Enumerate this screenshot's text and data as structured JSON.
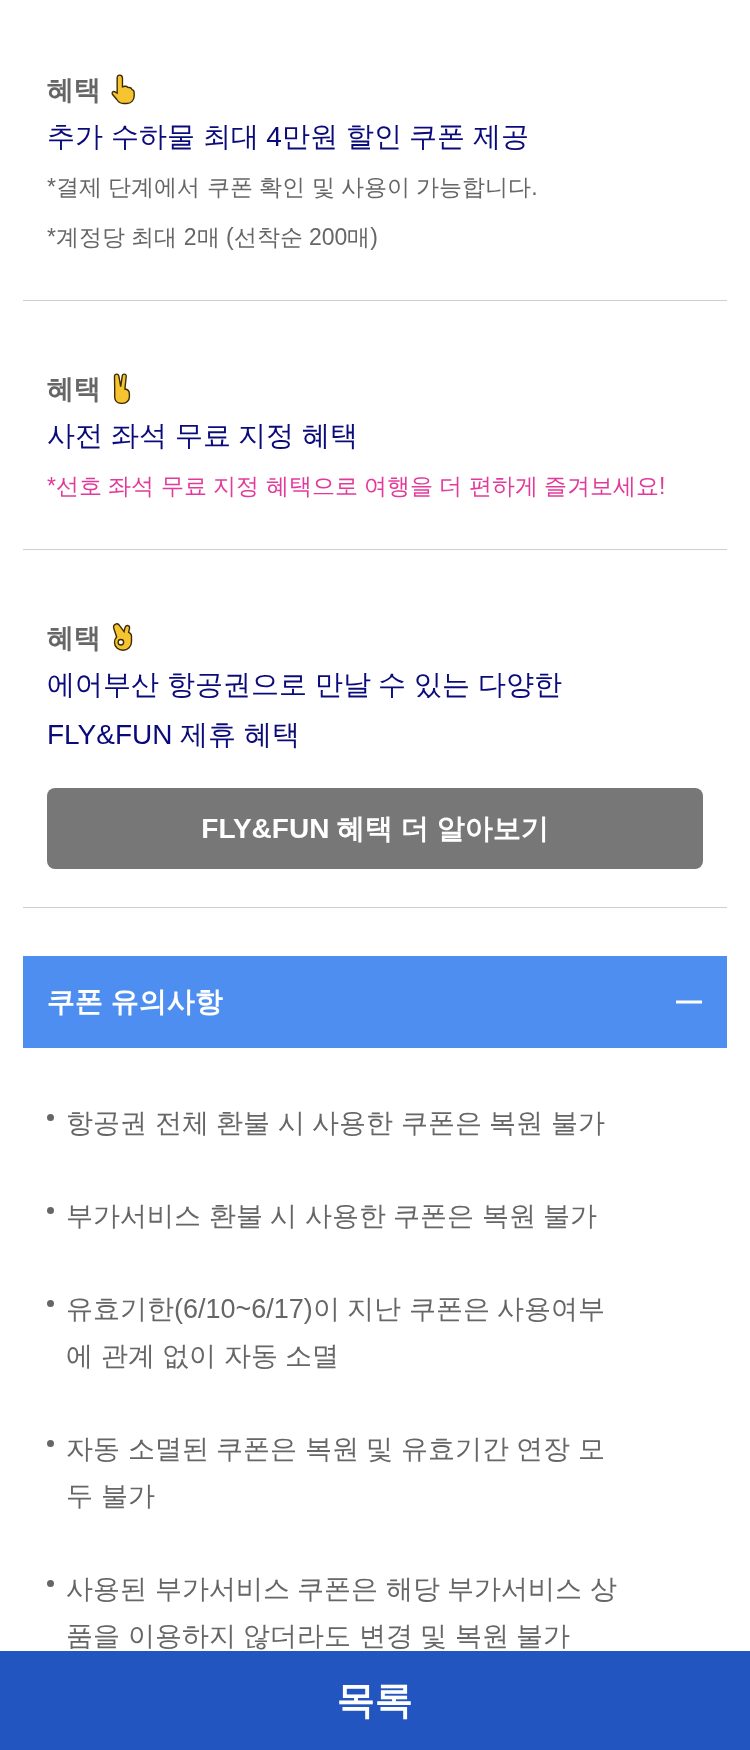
{
  "benefits": [
    {
      "heading": "혜택",
      "title": "추가 수하물 최대 4만원 할인 쿠폰 제공",
      "notes": [
        {
          "text": "*결제 단계에서 쿠폰 확인 및 사용이 가능합니다.",
          "kind": "info"
        },
        {
          "text": "*계정당 최대 2매 (선착순 200매)",
          "kind": "info"
        }
      ]
    },
    {
      "heading": "혜택",
      "title": "사전 좌석 무료 지정 혜택",
      "notes": [
        {
          "text": "*선호 좌석 무료 지정 혜택으로 여행을 더 편하게 즐겨보세요!",
          "kind": "highlight"
        }
      ]
    },
    {
      "heading": "혜택",
      "title": "에어부산 항공권으로 만날 수 있는 다양한\nFLY&FUN 제휴 혜택",
      "button": "FLY&FUN 혜택 더 알아보기"
    }
  ],
  "notice": {
    "title": "쿠폰 유의사항",
    "expanded": true,
    "items": [
      "항공권 전체 환불 시 사용한 쿠폰은 복원 불가",
      "부가서비스 환불 시 사용한 쿠폰은 복원 불가",
      "유효기한(6/10~6/17)이 지난 쿠폰은 사용여부\n에 관계 없이 자동 소멸",
      "자동 소멸된 쿠폰은 복원 및 유효기간 연장 모\n두 불가",
      "사용된 부가서비스 쿠폰은 해당 부가서비스 상\n품을 이용하지 않더라도 변경 및 복원 불가"
    ]
  },
  "bottom_button": "목록"
}
